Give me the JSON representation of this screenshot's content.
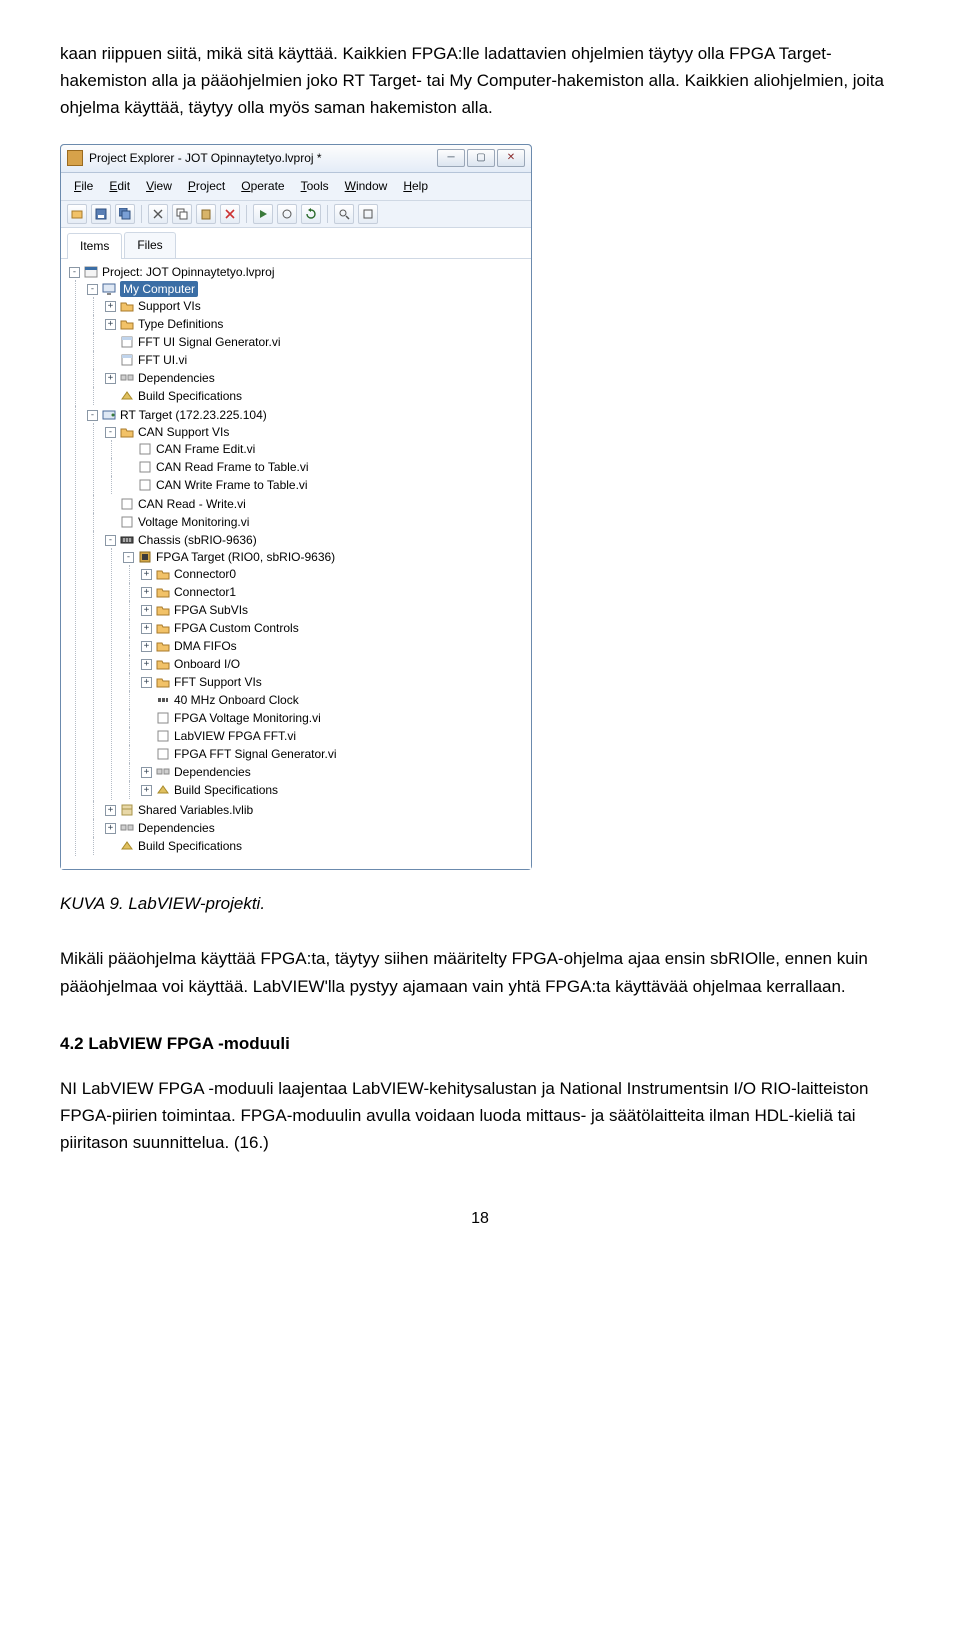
{
  "para1": "kaan riippuen siitä, mikä sitä käyttää. Kaikkien FPGA:lle ladattavien ohjelmien täytyy olla FPGA Target-hakemiston alla ja pääohjelmien joko RT Target- tai My Computer-hakemiston alla. Kaikkien aliohjelmien, joita ohjelma käyttää, täytyy olla myös saman hakemiston alla.",
  "window": {
    "title": "Project Explorer - JOT Opinnaytetyo.lvproj *",
    "menus": [
      "File",
      "Edit",
      "View",
      "Project",
      "Operate",
      "Tools",
      "Window",
      "Help"
    ],
    "tabs": [
      "Items",
      "Files"
    ],
    "tree": {
      "project": "Project: JOT Opinnaytetyo.lvproj",
      "myComputer": "My Computer",
      "mc_children": [
        "Support VIs",
        "Type Definitions",
        "FFT UI Signal Generator.vi",
        "FFT UI.vi",
        "Dependencies",
        "Build Specifications"
      ],
      "rtTarget": "RT Target (172.23.225.104)",
      "canSupport": "CAN Support VIs",
      "can_children": [
        "CAN Frame Edit.vi",
        "CAN Read Frame to Table.vi",
        "CAN Write Frame to Table.vi"
      ],
      "rt_children": [
        "CAN Read - Write.vi",
        "Voltage Monitoring.vi"
      ],
      "chassis": "Chassis (sbRIO-9636)",
      "fpgaTarget": "FPGA Target (RIO0, sbRIO-9636)",
      "fpga_children": [
        "Connector0",
        "Connector1",
        "FPGA SubVIs",
        "FPGA Custom Controls",
        "DMA FIFOs",
        "Onboard I/O",
        "FFT Support VIs",
        "40 MHz Onboard Clock",
        "FPGA Voltage Monitoring.vi",
        "LabVIEW FPGA FFT.vi",
        "FPGA FFT Signal Generator.vi",
        "Dependencies",
        "Build Specifications"
      ],
      "sharedVars": "Shared Variables.lvlib",
      "rt_tail": [
        "Dependencies",
        "Build Specifications"
      ]
    }
  },
  "caption": "KUVA 9. LabVIEW-projekti.",
  "para2": "Mikäli pääohjelma käyttää FPGA:ta, täytyy siihen määritelty FPGA-ohjelma ajaa ensin sbRIOlle, ennen kuin pääohjelmaa voi käyttää. LabVIEW'lla pystyy ajamaan vain yhtä FPGA:ta käyttävää ohjelmaa kerrallaan.",
  "heading": "4.2 LabVIEW FPGA -moduuli",
  "para3": "NI LabVIEW FPGA -moduuli laajentaa LabVIEW-kehitysalustan ja National Instrumentsin I/O RIO-laitteiston FPGA-piirien toimintaa. FPGA-moduulin avulla voidaan luoda mittaus- ja säätölaitteita ilman HDL-kieliä tai piiritason suunnittelua. (16.)",
  "pageNum": "18"
}
